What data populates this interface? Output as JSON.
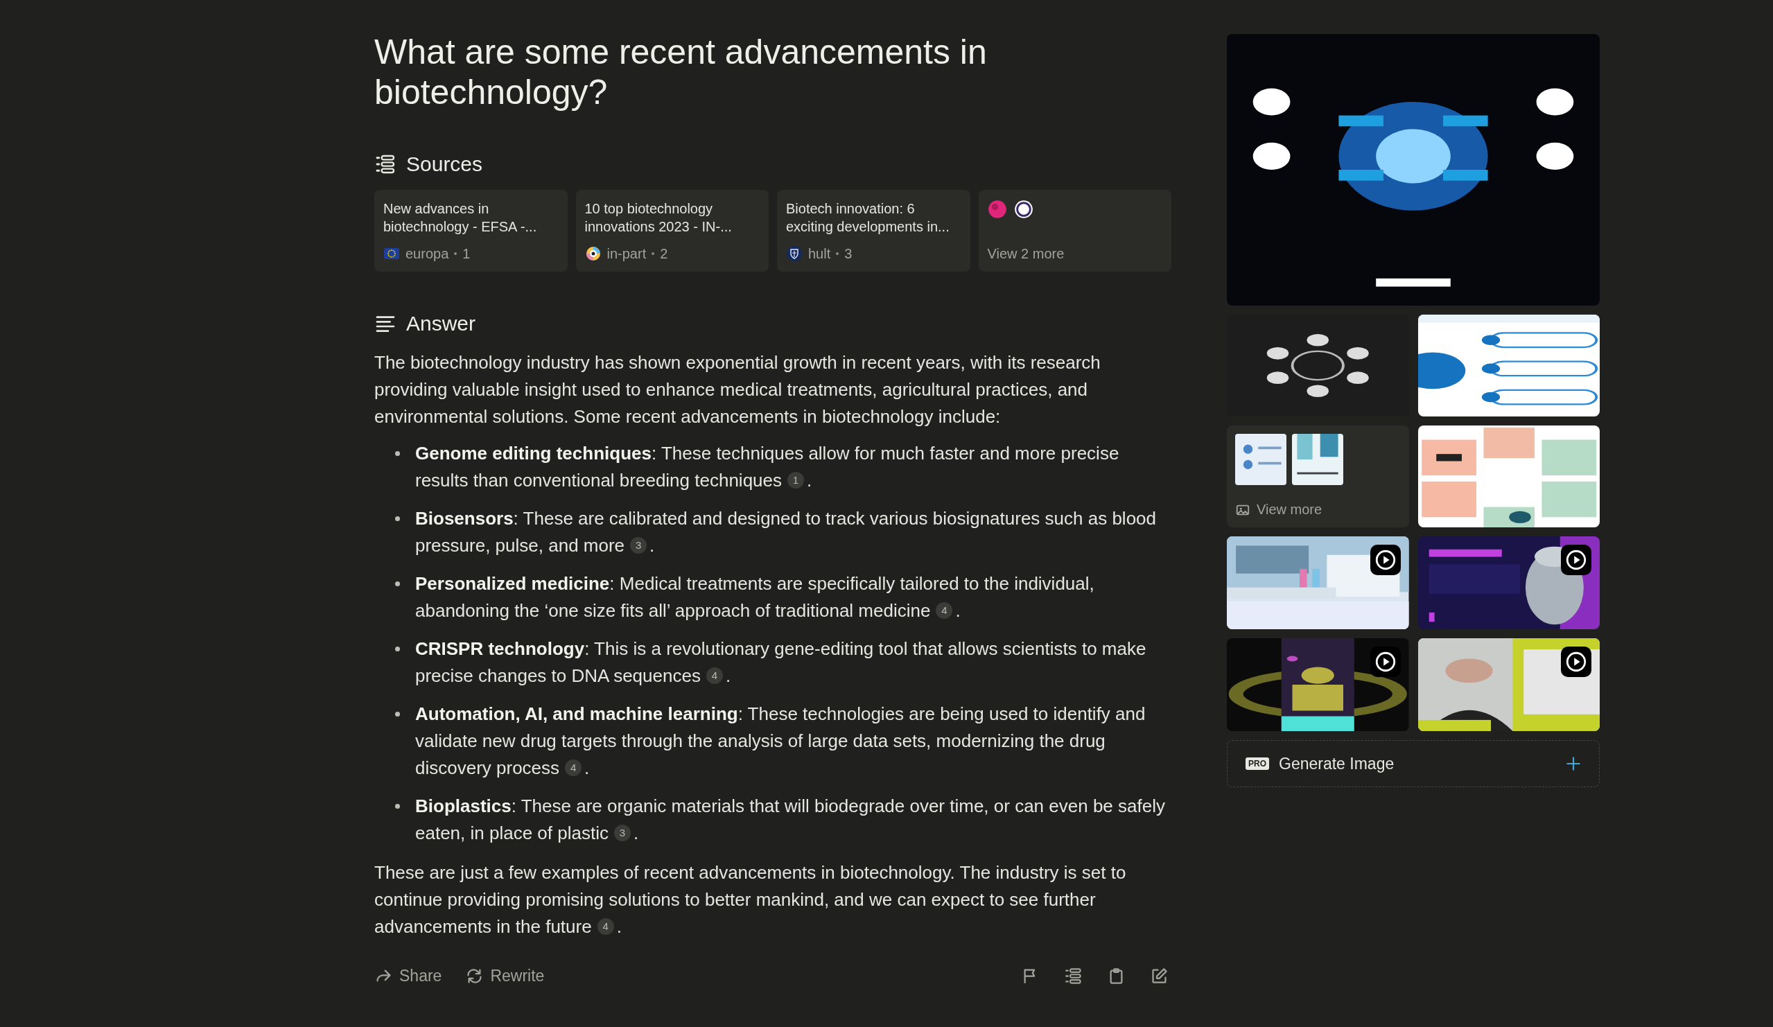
{
  "question": "What are some recent advancements in biotechnology?",
  "sources": {
    "heading": "Sources",
    "items": [
      {
        "title": "New advances in biotechnology - EFSA -...",
        "site": "europa",
        "count": "1",
        "kind": "flag"
      },
      {
        "title": "10 top biotechnology innovations 2023 - IN-...",
        "site": "in-part",
        "count": "2",
        "kind": "ring"
      },
      {
        "title": "Biotech innovation: 6 exciting developments in...",
        "site": "hult",
        "count": "3",
        "kind": "shield"
      }
    ],
    "more": {
      "label": "View 2 more"
    }
  },
  "answer": {
    "heading": "Answer",
    "intro": "The biotechnology industry has shown exponential growth in recent years, with its research providing valuable insight used to enhance medical treatments, agricultural practices, and environmental solutions. Some recent advancements in biotechnology include:",
    "points": [
      {
        "text": "**Genome editing techniques**: These techniques allow for much faster and more precise results than conventional breeding techniques",
        "citation": "1",
        "end": "."
      },
      {
        "text": "**Biosensors**: These are calibrated and designed to track various biosignatures such as blood pressure, pulse, and more",
        "citation": "3",
        "end": "."
      },
      {
        "text": "**Personalized medicine**: Medical treatments are specifically tailored to the individual, abandoning the ‘one size fits all’ approach of traditional medicine",
        "citation": "4",
        "end": "."
      },
      {
        "text": "**CRISPR technology**: This is a revolutionary gene-editing tool that allows scientists to make precise changes to DNA sequences",
        "citation": "4",
        "end": "."
      },
      {
        "text": "**Automation, AI, and machine learning**: These technologies are being used to identify and validate new drug targets through the analysis of large data sets, modernizing the drug discovery process",
        "citation": "4",
        "end": "."
      },
      {
        "text": "**Bioplastics**: These are organic materials that will biodegrade over time, or can even be safely eaten, in place of plastic",
        "citation": "3",
        "end": "."
      }
    ],
    "conclusion": {
      "text": "These are just a few examples of recent advancements in biotechnology. The industry is set to continue providing promising solutions to better mankind, and we can expect to see further advancements in the future",
      "citation": "4",
      "end": "."
    }
  },
  "actions": {
    "share": "Share",
    "rewrite": "Rewrite"
  },
  "media": {
    "items": [
      {
        "kind": "picture"
      },
      {
        "kind": "picture"
      },
      {
        "kind": "picture"
      },
      {
        "kind": "gallery",
        "label": "View more"
      },
      {
        "kind": "picture"
      },
      {
        "kind": "video"
      },
      {
        "kind": "video"
      },
      {
        "kind": "video"
      },
      {
        "kind": "video"
      }
    ],
    "generate": {
      "badge": "PRO",
      "label": "Generate Image"
    }
  }
}
